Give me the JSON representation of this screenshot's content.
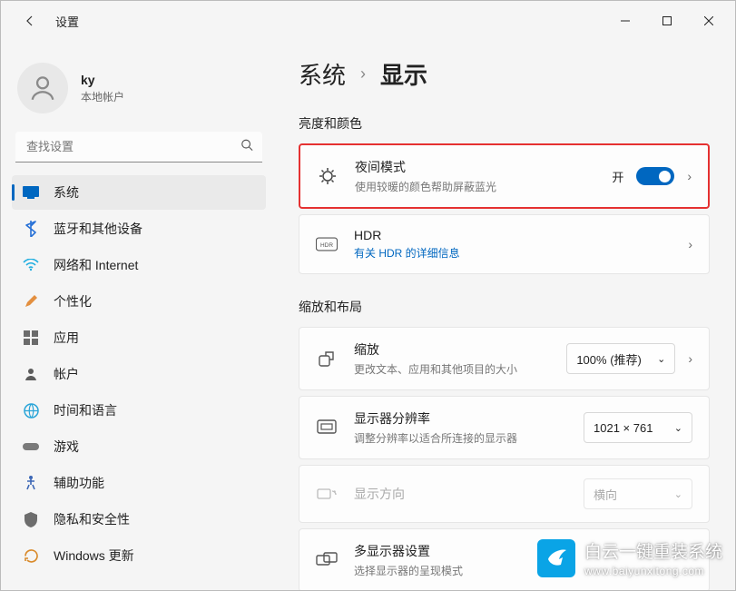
{
  "window": {
    "title": "设置"
  },
  "profile": {
    "name": "ky",
    "subtitle": "本地帐户"
  },
  "search": {
    "placeholder": "查找设置"
  },
  "nav": {
    "system": "系统",
    "bluetooth": "蓝牙和其他设备",
    "network": "网络和 Internet",
    "personalize": "个性化",
    "apps": "应用",
    "accounts": "帐户",
    "time": "时间和语言",
    "gaming": "游戏",
    "accessibility": "辅助功能",
    "privacy": "隐私和安全性",
    "update": "Windows 更新"
  },
  "breadcrumb": {
    "root": "系统",
    "current": "显示"
  },
  "sections": {
    "brightness": "亮度和颜色",
    "scale": "缩放和布局"
  },
  "cards": {
    "nightlight": {
      "title": "夜间模式",
      "sub": "使用较暖的颜色帮助屏蔽蓝光",
      "toggle_label": "开",
      "toggle_on": true
    },
    "hdr": {
      "title": "HDR",
      "link": "有关 HDR 的详细信息"
    },
    "scale": {
      "title": "缩放",
      "sub": "更改文本、应用和其他项目的大小",
      "value": "100% (推荐)"
    },
    "resolution": {
      "title": "显示器分辨率",
      "sub": "调整分辨率以适合所连接的显示器",
      "value": "1021 × 761"
    },
    "orientation": {
      "title": "显示方向",
      "value": "横向"
    },
    "multi": {
      "title": "多显示器设置",
      "sub": "选择显示器的呈现模式"
    }
  },
  "watermark": {
    "main": "白云一键重装系统",
    "sub": "www.baiyunxitong.com"
  }
}
